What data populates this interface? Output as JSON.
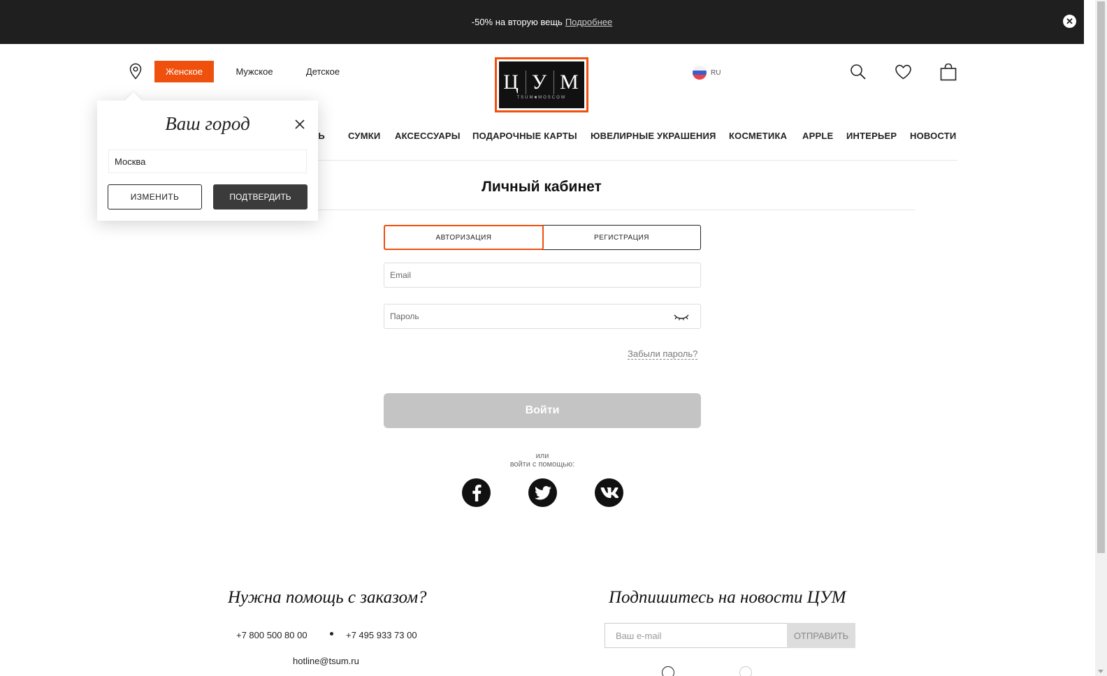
{
  "promo": {
    "text": "-50% на вторую вещь",
    "link": "Подробнее",
    "close_icon": "close-icon"
  },
  "header": {
    "genders": [
      "Женское",
      "Мужское",
      "Детское"
    ],
    "active_gender": "Женское",
    "logo": {
      "letters": [
        "Ц",
        "У",
        "М"
      ],
      "sub": "TSUM■MOSCOW"
    },
    "language": "RU",
    "icons": [
      "location-pin-icon",
      "search-icon",
      "heart-icon",
      "bag-icon"
    ],
    "accent_color": "#f0500d"
  },
  "nav": {
    "items": [
      "ОБУВЬ",
      "СУМКИ",
      "АКСЕССУАРЫ",
      "ПОДАРОЧНЫЕ КАРТЫ",
      "ЮВЕЛИРНЫЕ УКРАШЕНИЯ",
      "КОСМЕТИКА",
      "APPLE",
      "ИНТЕРЬЕР",
      "НОВОСТИ"
    ]
  },
  "main": {
    "title": "Личный кабинет",
    "tabs": [
      {
        "label": "АВТОРИЗАЦИЯ",
        "active": true
      },
      {
        "label": "РЕГИСТРАЦИЯ",
        "active": false
      }
    ],
    "email_placeholder": "Email",
    "password_placeholder": "Пароль",
    "forgot_password": "Забыли пароль?",
    "login_button": "Войти",
    "or_text": "или",
    "social_text": "войти с помощью:",
    "socials": [
      "facebook-icon",
      "twitter-icon",
      "vk-icon"
    ]
  },
  "footer": {
    "help_title": "Нужна помощь с заказом?",
    "phones": [
      "+7 800 500 80 00",
      "+7 495 933 73 00"
    ],
    "email": "hotline@tsum.ru",
    "subscribe_title": "Подпишитесь на новости ЦУМ",
    "subscribe_placeholder": "Ваш e-mail",
    "subscribe_button": "ОТПРАВИТЬ"
  },
  "city_popup": {
    "title": "Ваш город",
    "value": "Москва",
    "change_button": "ИЗМЕНИТЬ",
    "confirm_button": "ПОДТВЕРДИТЬ"
  }
}
